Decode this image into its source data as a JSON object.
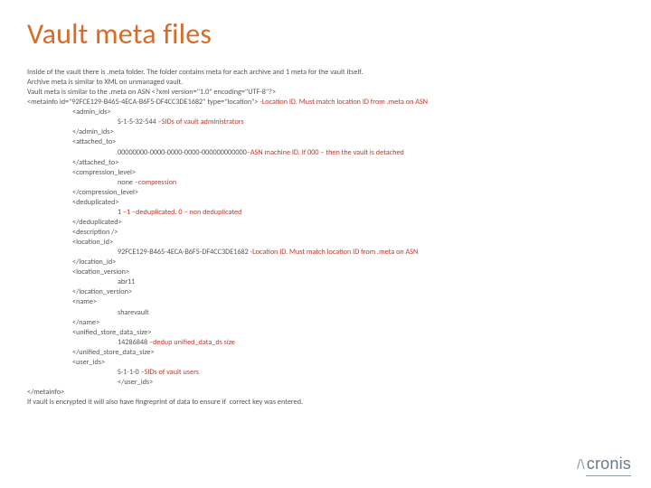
{
  "title": "Vault meta files",
  "intro1": "Inside of the vault there is .meta folder. The folder contains meta for each archive and 1 meta for the vault itself.",
  "intro2": "Archive meta is similar to XML on unmanaged vault.",
  "intro3_a": "Vault meta is similar to the .meta on ASN ",
  "intro3_b": "<?xml version=\"1.0\" encoding=\"UTF-8\"?>",
  "x": {
    "open_a": "<metainfo id=\"92FCE129-B465-4ECA-B6F5-DF4CC3DE1682\" type=\"location\">",
    "open_note": " -Location ID. Must match location ID from .meta on ASN",
    "admin_open": "<admin_ids>",
    "admin_val": "S-1-5-32-544",
    "admin_note": " –SIDs of vault administrators",
    "admin_close": "</admin_ids>",
    "attached_open": "<attached_to>",
    "attached_val": "00000000-0000-0000-0000-000000000000",
    "attached_note": "–ASN machine ID. If 000 – then the vault is detached",
    "attached_close": "</attached_to>",
    "comp_open": "<compression_level>",
    "comp_val": "none",
    "comp_note": " –compression",
    "comp_close": "</compression_level>",
    "dedup_open": "<deduplicated>",
    "dedup_val": "1",
    "dedup_note": " –1 –deduplicated. 0 – non deduplicated",
    "dedup_close": "</deduplicated>",
    "descr": "<description />",
    "loc_open": "<location_id>",
    "loc_val": "92FCE129-B465-4ECA-B6F5-DF4CC3DE1682",
    "loc_note": " -Location ID. Must match location ID from .meta on ASN",
    "loc_close": "</location_id>",
    "ver_open": "<location_version>",
    "ver_val": "abr11",
    "ver_close": "</location_version>",
    "name_open": "<name>",
    "name_val": "sharevault",
    "name_close": "</name>",
    "usds_open": "<unified_store_data_size>",
    "usds_val": "14286848",
    "usds_note": " –dedup unified_data_ds size",
    "usds_close": "</unified_store_data_size>",
    "uids_open": "<user_ids>",
    "uids_val": "S-1-1-0",
    "uids_note": " –SIDs of vault users",
    "uids_close": "</user_ids>",
    "meta_close": "</metainfo>"
  },
  "footer": "If vault is encrypted it will also have fingreprint of data to ensure if  correct key was entered.",
  "brand": "cronis"
}
